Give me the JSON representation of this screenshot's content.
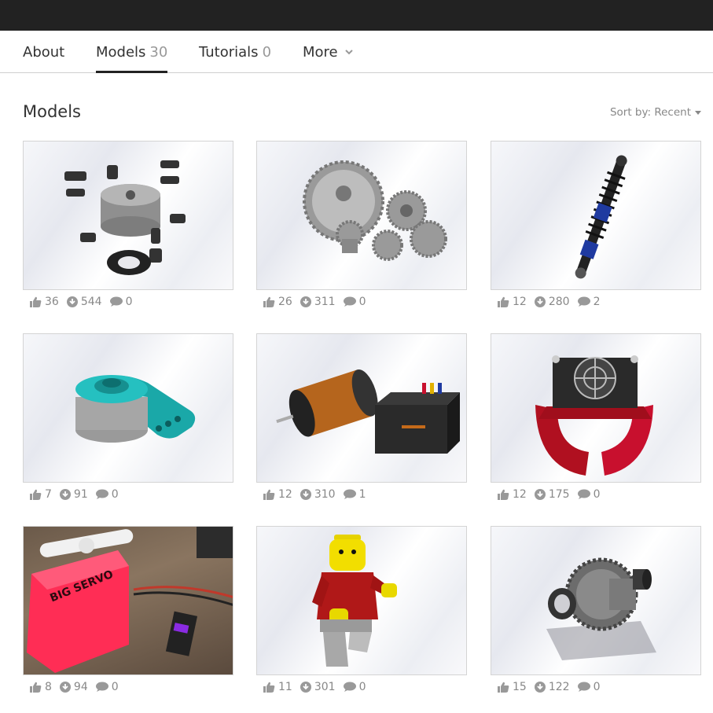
{
  "tabs": [
    {
      "label": "About",
      "count": ""
    },
    {
      "label": "Models",
      "count": "30"
    },
    {
      "label": "Tutorials",
      "count": "0"
    },
    {
      "label": "More",
      "count": ""
    }
  ],
  "section": {
    "title": "Models",
    "sort_label": "Sort by: Recent"
  },
  "models": [
    {
      "subject": "exploded lathe chuck",
      "likes": "36",
      "downloads": "544",
      "comments": "0"
    },
    {
      "subject": "spur gears set",
      "likes": "26",
      "downloads": "311",
      "comments": "0"
    },
    {
      "subject": "shock absorber",
      "likes": "12",
      "downloads": "280",
      "comments": "2"
    },
    {
      "subject": "servo horn",
      "likes": "7",
      "downloads": "91",
      "comments": "0"
    },
    {
      "subject": "motor and ESC",
      "likes": "12",
      "downloads": "310",
      "comments": "1"
    },
    {
      "subject": "motor heatsink with fan",
      "likes": "12",
      "downloads": "175",
      "comments": "0"
    },
    {
      "subject": "big servo photo",
      "likes": "8",
      "downloads": "94",
      "comments": "0",
      "photo_text": "BIG SERVO"
    },
    {
      "subject": "lego minifigure",
      "likes": "11",
      "downloads": "301",
      "comments": "0"
    },
    {
      "subject": "differential",
      "likes": "15",
      "downloads": "122",
      "comments": "0"
    }
  ],
  "colors": {
    "topbar": "#222222",
    "muted": "#888888",
    "teal": "#20b2b2",
    "red": "#c8102e",
    "pink": "#ff3b6b"
  },
  "icons": [
    "thumbs-up-icon",
    "download-icon",
    "comment-icon",
    "chevron-down-icon",
    "caret-down-icon"
  ]
}
